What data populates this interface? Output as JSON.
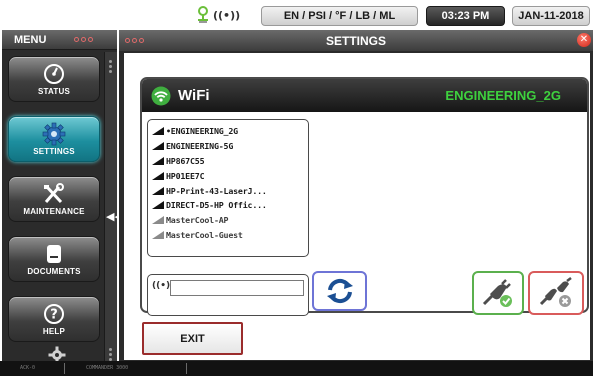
{
  "top_bar": {
    "units": "EN / PSI / °F / LB / ML",
    "time": "03:23 PM",
    "date": "JAN-11-2018"
  },
  "menu": {
    "title": "MENU",
    "items": [
      {
        "label": "STATUS",
        "icon": "gauge-icon",
        "active": false
      },
      {
        "label": "SETTINGS",
        "icon": "gear-icon",
        "active": true
      },
      {
        "label": "MAINTENANCE",
        "icon": "tools-icon",
        "active": false
      },
      {
        "label": "DOCUMENTS",
        "icon": "document-icon",
        "active": false
      },
      {
        "label": "HELP",
        "icon": "question-icon",
        "active": false
      }
    ]
  },
  "window": {
    "title": "SETTINGS"
  },
  "wifi": {
    "label": "WiFi",
    "connected_ssid": "ENGINEERING_2G",
    "networks": [
      {
        "name": "ENGINEERING_2G",
        "connected": true,
        "signal": "strong"
      },
      {
        "name": "ENGINEERING-5G",
        "connected": false,
        "signal": "strong"
      },
      {
        "name": "HP867C55",
        "connected": false,
        "signal": "strong"
      },
      {
        "name": "HP01EE7C",
        "connected": false,
        "signal": "strong"
      },
      {
        "name": "HP-Print-43-LaserJ...",
        "connected": false,
        "signal": "strong"
      },
      {
        "name": "DIRECT-D5-HP Offic...",
        "connected": false,
        "signal": "strong"
      },
      {
        "name": "MasterCool-AP",
        "connected": false,
        "signal": "weak"
      },
      {
        "name": "MasterCool-Guest",
        "connected": false,
        "signal": "weak"
      }
    ],
    "password_value": "",
    "exit_label": "EXIT"
  },
  "colors": {
    "accent_active": "#1d8f9f",
    "ssid_green": "#3ed13e",
    "connect_border": "#5bb04d",
    "disconnect_border": "#d95b5b",
    "refresh_border": "#6e74d6",
    "exit_border": "#9a2c2c"
  },
  "footer": {
    "left_text": "ACK-0",
    "mid_text": "COMMANDER 3000"
  }
}
